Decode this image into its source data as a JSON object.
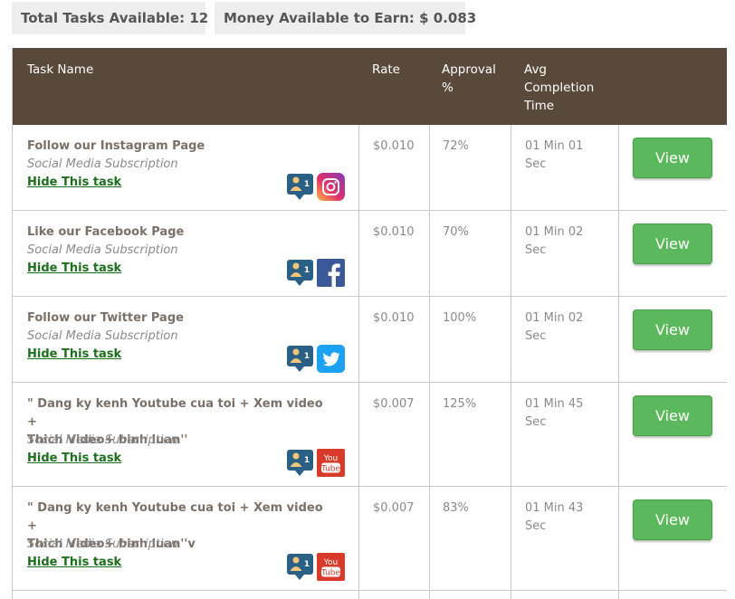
{
  "stats": {
    "tasks_label": "Total Tasks Available: 12",
    "money_label": "Money Available to Earn: $ 0.083"
  },
  "table": {
    "headers": {
      "task_name": "Task Name",
      "rate": "Rate",
      "approval_1": "Approval",
      "approval_2": "%",
      "avg_1": "Avg",
      "avg_2": "Completion",
      "avg_3": "Time"
    },
    "rows": [
      {
        "name_1": "Follow our Instagram Page",
        "name_2": "",
        "category": "Social Media Subscription",
        "hide": "Hide This task",
        "rate": "$0.010",
        "approval": "72%",
        "time_1": "01 Min 01",
        "time_2": "Sec",
        "view": "View",
        "platform_icon": "instagram-icon",
        "user_count": "1"
      },
      {
        "name_1": "Like our Facebook Page",
        "name_2": "",
        "category": "Social Media Subscription",
        "hide": "Hide This task",
        "rate": "$0.010",
        "approval": "70%",
        "time_1": "01 Min 02",
        "time_2": "Sec",
        "view": "View",
        "platform_icon": "facebook-icon",
        "user_count": "1"
      },
      {
        "name_1": "Follow our Twitter Page",
        "name_2": "",
        "category": "Social Media Subscription",
        "hide": "Hide This task",
        "rate": "$0.010",
        "approval": "100%",
        "time_1": "01 Min 02",
        "time_2": "Sec",
        "view": "View",
        "platform_icon": "twitter-icon",
        "user_count": "1"
      },
      {
        "name_1": "\" Dang ky kenh Youtube cua toi + Xem video +",
        "name_2": "Thich Video+ binh luan''",
        "category": "Social Media Subscription",
        "hide": "Hide This task",
        "rate": "$0.007",
        "approval": "125%",
        "time_1": "01 Min 45",
        "time_2": "Sec",
        "view": "View",
        "platform_icon": "youtube-icon",
        "user_count": "1",
        "youtube_top": "You",
        "youtube_bottom": "Tube"
      },
      {
        "name_1": "\" Dang ky kenh Youtube cua toi + Xem video +",
        "name_2": "Thich Video+ binh luan''v",
        "category": "Social Media Subscription",
        "hide": "Hide This task",
        "rate": "$0.007",
        "approval": "83%",
        "time_1": "01 Min 43",
        "time_2": "Sec",
        "view": "View",
        "platform_icon": "youtube-icon",
        "user_count": "1",
        "youtube_top": "You",
        "youtube_bottom": "Tube"
      }
    ]
  },
  "colors": {
    "header_bg": "#58493b",
    "button_green": "#5cb85c",
    "link_green": "#1c6f1c",
    "instagram": "#c13584",
    "facebook": "#3b5998",
    "twitter": "#1da1f2",
    "youtube": "#d93b2a",
    "user_badge": "#2a5f86"
  }
}
